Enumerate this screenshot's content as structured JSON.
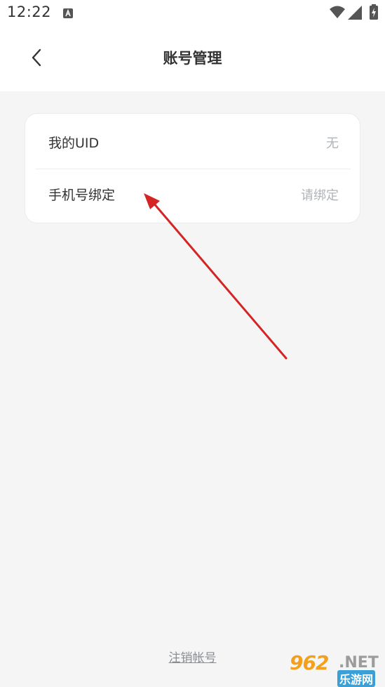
{
  "status_bar": {
    "time": "12:22",
    "notification_icon": "a-letter-icon",
    "icons": [
      "wifi-icon",
      "cell-signal-icon",
      "battery-charging-icon"
    ]
  },
  "header": {
    "back_icon": "chevron-left-icon",
    "title": "账号管理"
  },
  "account_card": {
    "rows": [
      {
        "label": "我的UID",
        "value": "无"
      },
      {
        "label": "手机号绑定",
        "value": "请绑定"
      }
    ]
  },
  "footer": {
    "cancel_account_label": "注销帐号"
  },
  "watermark": {
    "number": "962",
    "suffix": ".NET",
    "chinese": "乐游网"
  },
  "colors": {
    "background": "#f5f5f5",
    "arrow": "#d42424",
    "watermark_orange": "#f2a01e",
    "watermark_blue": "#3aa0d8"
  }
}
